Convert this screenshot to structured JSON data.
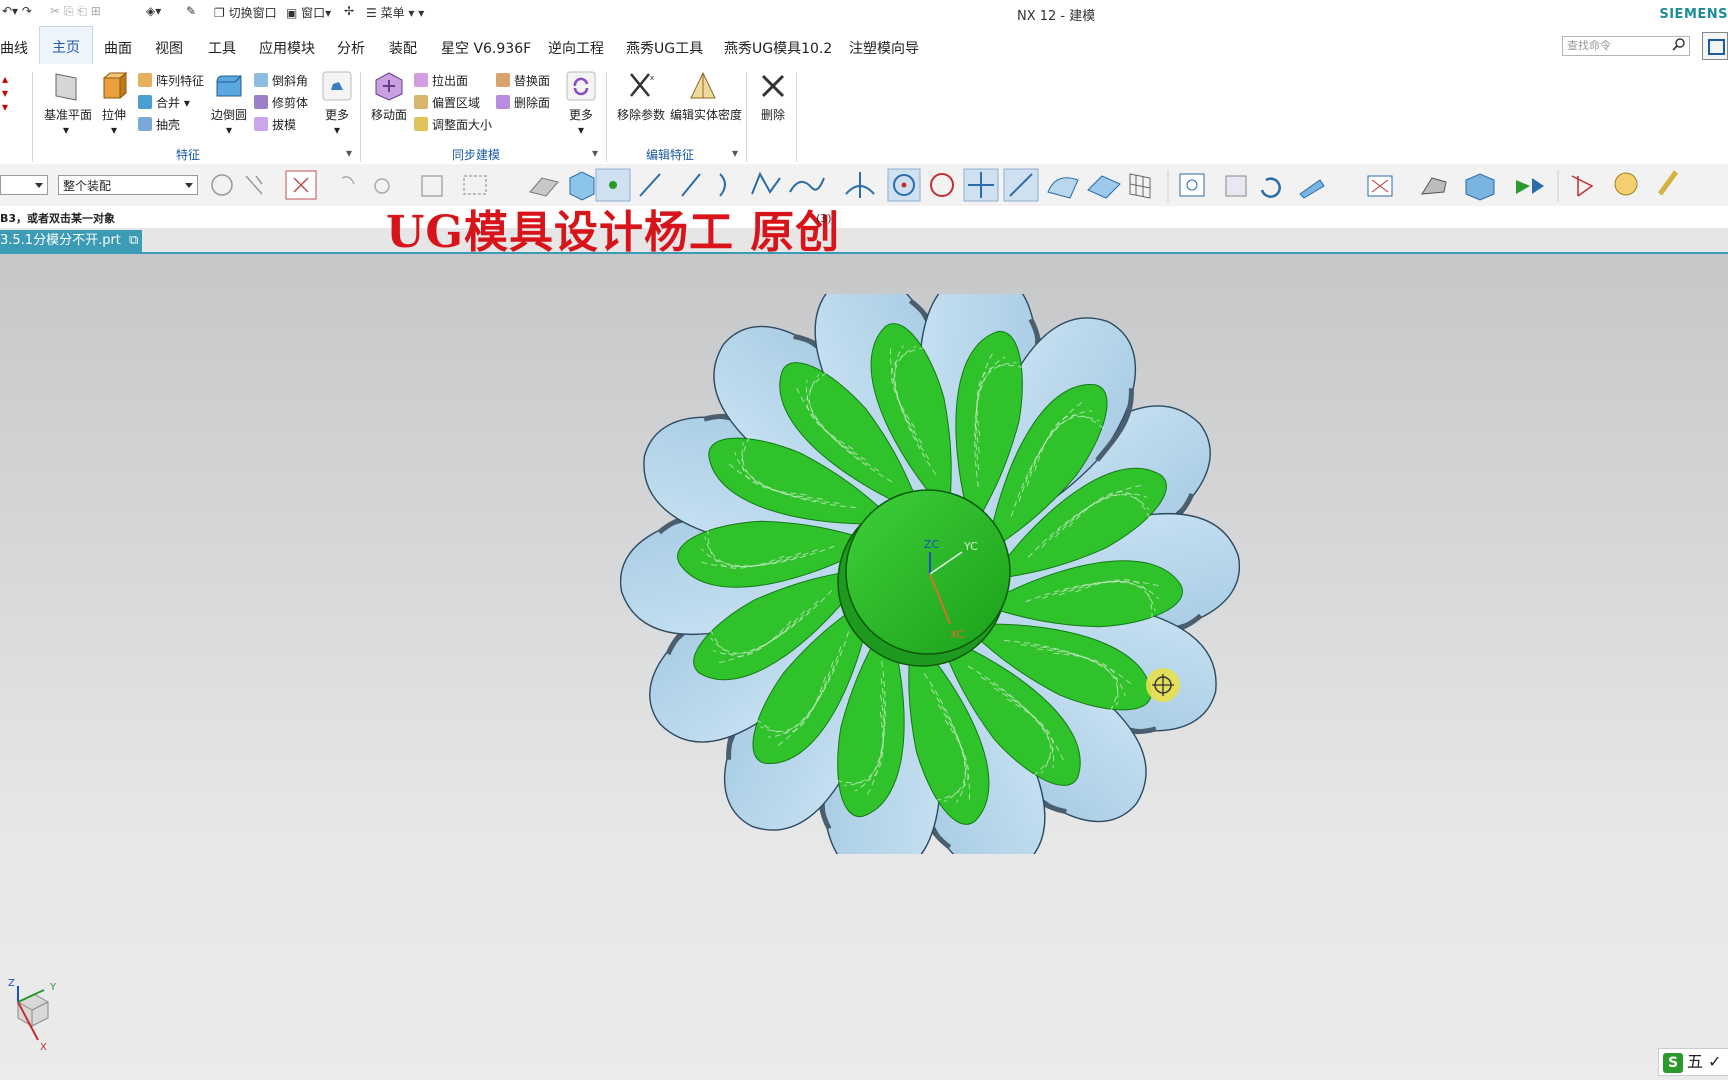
{
  "window": {
    "title": "NX 12 - 建模",
    "brand": "SIEMENS"
  },
  "quick_access": {
    "switch_window": "切换窗口",
    "window_menu": "窗口",
    "menu": "菜单"
  },
  "tabs": [
    "曲线",
    "主页",
    "曲面",
    "视图",
    "工具",
    "应用模块",
    "分析",
    "装配",
    "星空 V6.936F",
    "逆向工程",
    "燕秀UG工具",
    "燕秀UG模具10.2",
    "注塑模向导"
  ],
  "active_tab": "主页",
  "search": {
    "placeholder": "查找命令"
  },
  "ribbon": {
    "feature": {
      "datum_plane": "基准平面",
      "extrude": "拉伸",
      "pattern_feature": "阵列特征",
      "unite": "合并",
      "shell": "抽壳",
      "edge_blend": "边倒圆",
      "chamfer": "倒斜角",
      "trim_body": "修剪体",
      "draft": "拔模",
      "more": "更多",
      "group_label": "特征"
    },
    "sync": {
      "move_face": "移动面",
      "pull_face": "拉出面",
      "offset_region": "偏置区域",
      "resize_face": "调整面大小",
      "replace_face": "替换面",
      "delete_face": "删除面",
      "more": "更多",
      "group_label": "同步建模"
    },
    "edit_feature": {
      "remove_params": "移除参数",
      "edit_density": "编辑实体密度",
      "group_label": "编辑特征"
    },
    "delete": "删除"
  },
  "toolbar": {
    "assembly_scope": "整个装配"
  },
  "status": {
    "prompt": "B3，或者双击某一对象",
    "suffix": "(3)"
  },
  "watermark": "UG模具设计杨工 原创",
  "document_tab": {
    "name": "3.5.1分模分不开.prt"
  },
  "viewport": {
    "csys_labels": [
      "ZC",
      "YC",
      "XC"
    ],
    "triad_labels": [
      "Z",
      "Y",
      "X"
    ]
  },
  "ime": {
    "label": "五"
  },
  "colors": {
    "accent": "#1a5aa6",
    "doc_tab": "#3c9bb5",
    "watermark": "#d8141b",
    "part_face": "#b9d8ee",
    "highlight": "#2fc22a"
  }
}
